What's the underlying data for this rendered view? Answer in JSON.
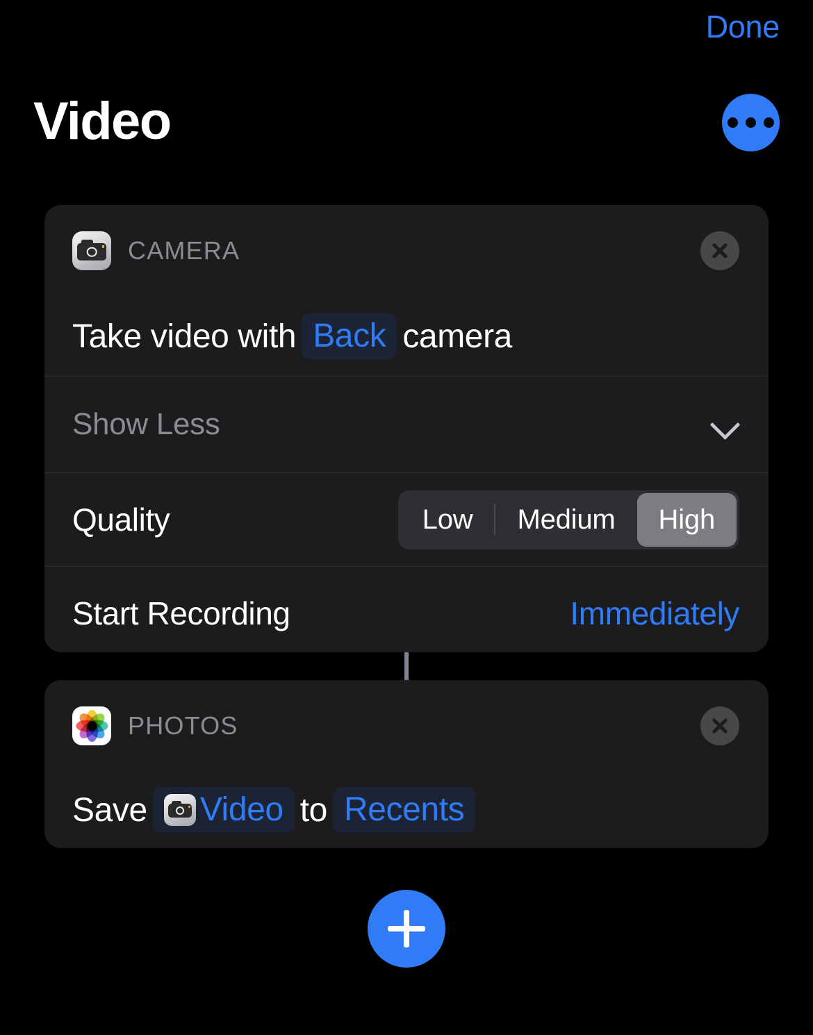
{
  "nav": {
    "done_label": "Done",
    "more_icon": "ellipsis-icon"
  },
  "header": {
    "title": "Video"
  },
  "shortcut": {
    "cards": [
      {
        "app_name": "CAMERA",
        "app_icon": "camera-app-icon",
        "close_icon": "close-icon",
        "action": {
          "text_before": "Take video with",
          "token_label": "Back",
          "text_after": "camera"
        },
        "disclosure": {
          "label": "Show Less",
          "icon": "chevron-down-icon"
        },
        "settings": [
          {
            "label": "Quality",
            "type": "segmented",
            "options": [
              "Low",
              "Medium",
              "High"
            ],
            "selected": "High"
          },
          {
            "label": "Start Recording",
            "type": "value",
            "value": "Immediately"
          }
        ]
      },
      {
        "app_name": "PHOTOS",
        "app_icon": "photos-app-icon",
        "close_icon": "close-icon",
        "action": {
          "text_before": "Save",
          "token_label": "Video",
          "token_icon": "camera-app-icon",
          "text_middle": "to",
          "token2_label": "Recents"
        }
      }
    ]
  },
  "add_action": {
    "icon": "plus-icon"
  },
  "colors": {
    "accent": "#2f7cf6",
    "background": "#000000",
    "card": "#1c1c1e",
    "token_bg": "#1b2335",
    "secondary_text": "#8c8c90",
    "segment_track": "#2e2e33",
    "segment_selected": "#7c7c81",
    "connector": "#7e848b"
  }
}
